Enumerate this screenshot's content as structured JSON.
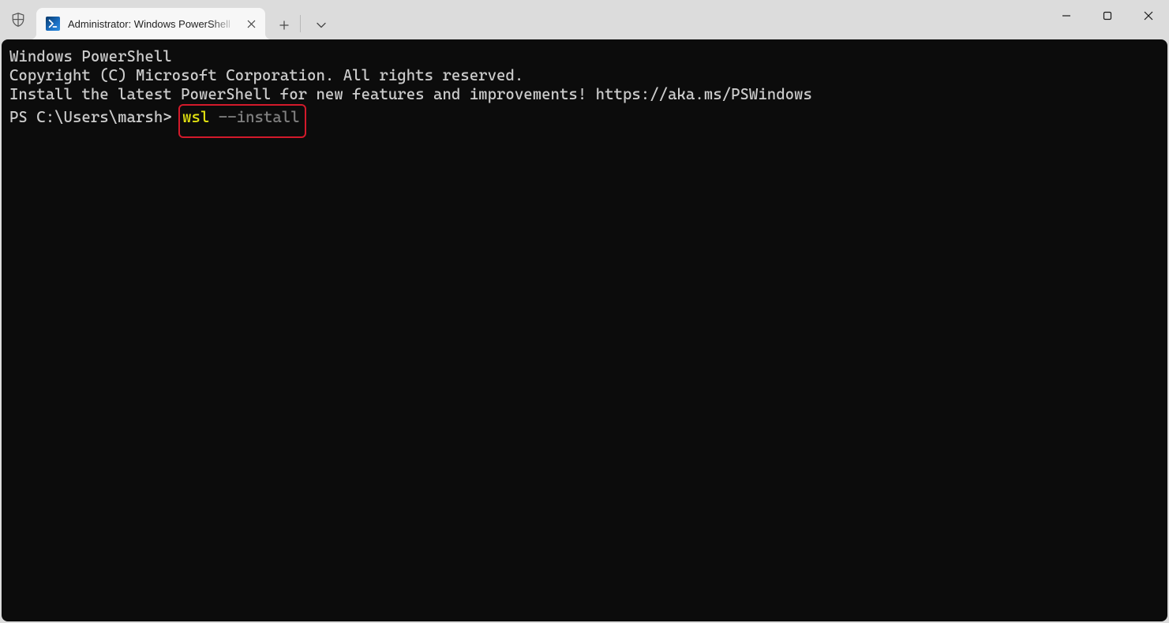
{
  "titlebar": {
    "tab": {
      "icon": "powershell-icon",
      "title": "Administrator: Windows PowerShell"
    }
  },
  "terminal": {
    "lines": {
      "header1": "Windows PowerShell",
      "header2": "Copyright (C) Microsoft Corporation. All rights reserved.",
      "blank1": "",
      "notice": "Install the latest PowerShell for new features and improvements! https://aka.ms/PSWindows",
      "blank2": ""
    },
    "prompt": "PS C:\\Users\\marsh> ",
    "command": {
      "cmd": "wsl ",
      "arg": "--install"
    }
  }
}
